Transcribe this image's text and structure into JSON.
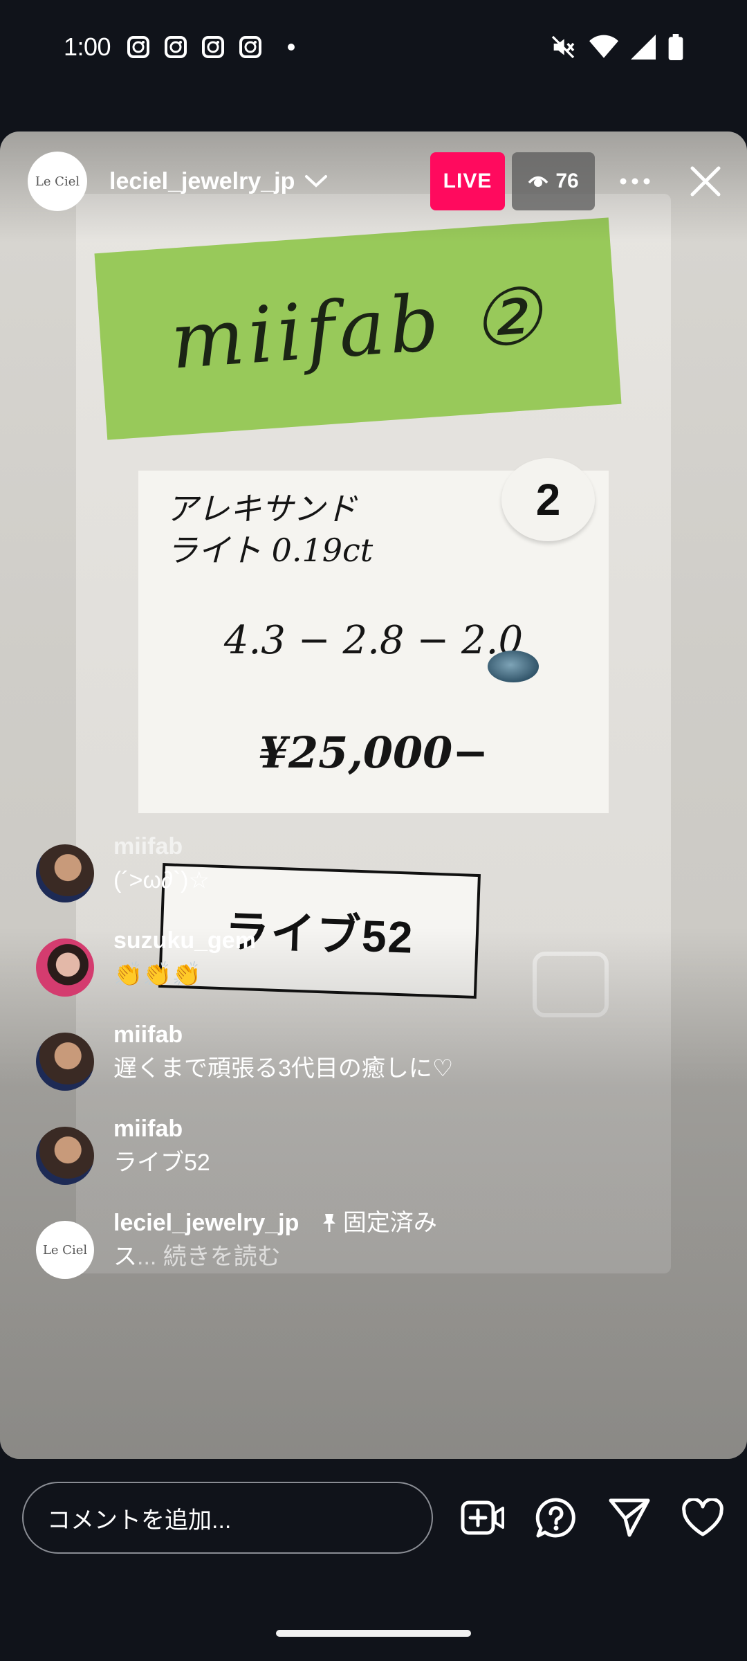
{
  "status_bar": {
    "time": "1:00",
    "app_icons": [
      "instagram-icon",
      "instagram-icon",
      "instagram-icon",
      "instagram-icon"
    ],
    "right_icons": [
      "mute-icon",
      "wifi-icon",
      "signal-icon",
      "battery-icon"
    ]
  },
  "live": {
    "host_avatar_text": "Le Ciel",
    "host_name": "leciel_jewelry_jp",
    "live_badge": "LIVE",
    "viewer_count": "76",
    "accent_color": "#ff0a5e"
  },
  "video": {
    "tape_text": "miifab ②",
    "paper1_line1": "アレキサンド",
    "paper1_line2": "ライト  0.19ct",
    "paper2_text": "4.3 − 2.8 − 2.0",
    "paper3_text": "¥25,000−",
    "disc_number": "2",
    "card_text": "ライブ52"
  },
  "comments": [
    {
      "user": "miifab",
      "text": "(´>ω∂`)☆",
      "avatar": "portrait"
    },
    {
      "user": "suzuku_gem",
      "text": "👏👏👏",
      "avatar": "portrait-pink"
    },
    {
      "user": "miifab",
      "text": "遅くまで頑張る3代目の癒しに♡",
      "avatar": "portrait"
    },
    {
      "user": "miifab",
      "text": "ライブ52",
      "avatar": "portrait"
    }
  ],
  "pinned_comment": {
    "user": "leciel_jewelry_jp",
    "pinned_label": "固定済み",
    "text": "ス",
    "ellipsis": "... ",
    "read_more": "続きを読む",
    "avatar_text": "Le Ciel"
  },
  "bottom_bar": {
    "comment_placeholder": "コメントを追加...",
    "icons": [
      "add-video-icon",
      "question-icon",
      "send-icon",
      "heart-icon"
    ]
  }
}
